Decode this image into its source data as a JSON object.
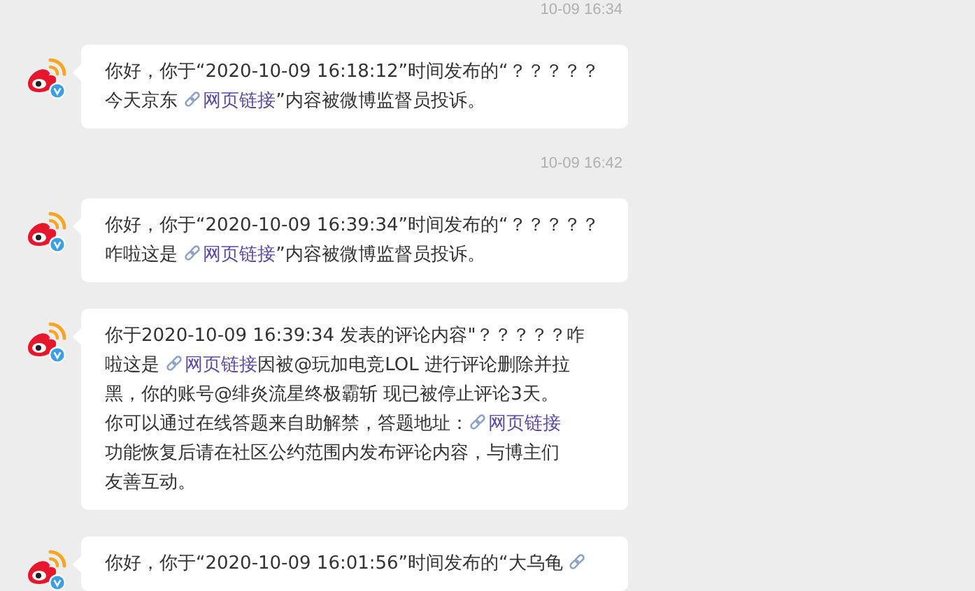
{
  "messages": [
    {
      "time": "10-09 16:34",
      "lines": [
        [
          {
            "kind": "text",
            "text": "你好，你于“2020-10-09 16:18:12”时间发布的“？？？？？"
          }
        ],
        [
          {
            "kind": "text",
            "text": "今天京东 "
          },
          {
            "kind": "link",
            "text": "网页链接"
          },
          {
            "kind": "text",
            "text": "”内容被微博监督员投诉。"
          }
        ]
      ]
    },
    {
      "time": "10-09 16:42",
      "lines": [
        [
          {
            "kind": "text",
            "text": "你好，你于“2020-10-09 16:39:34”时间发布的“？？？？？"
          }
        ],
        [
          {
            "kind": "text",
            "text": "咋啦这是 "
          },
          {
            "kind": "link",
            "text": "网页链接"
          },
          {
            "kind": "text",
            "text": "”内容被微博监督员投诉。"
          }
        ]
      ]
    },
    {
      "lines": [
        [
          {
            "kind": "text",
            "text": "你于2020-10-09 16:39:34 发表的评论内容\"？？？？？咋"
          }
        ],
        [
          {
            "kind": "text",
            "text": "啦这是 "
          },
          {
            "kind": "link",
            "text": "网页链接"
          },
          {
            "kind": "text",
            "text": "因被@玩加电竞LOL 进行评论删除并拉"
          }
        ],
        [
          {
            "kind": "text",
            "text": "黑，你的账号@绯炎流星终极霸斩 现已被停止评论3天。"
          }
        ],
        [
          {
            "kind": "text",
            "text": "你可以通过在线答题来自助解禁，答题地址："
          },
          {
            "kind": "link",
            "text": "网页链接"
          }
        ],
        [
          {
            "kind": "text",
            "text": "功能恢复后请在社区公约范围内发布评论内容，与博主们"
          }
        ],
        [
          {
            "kind": "text",
            "text": "友善互动。"
          }
        ]
      ]
    },
    {
      "lines": [
        [
          {
            "kind": "text",
            "text": "你好，你于“2020-10-09 16:01:56”时间发布的“大乌龟 "
          },
          {
            "kind": "link_icon"
          }
        ]
      ]
    }
  ]
}
